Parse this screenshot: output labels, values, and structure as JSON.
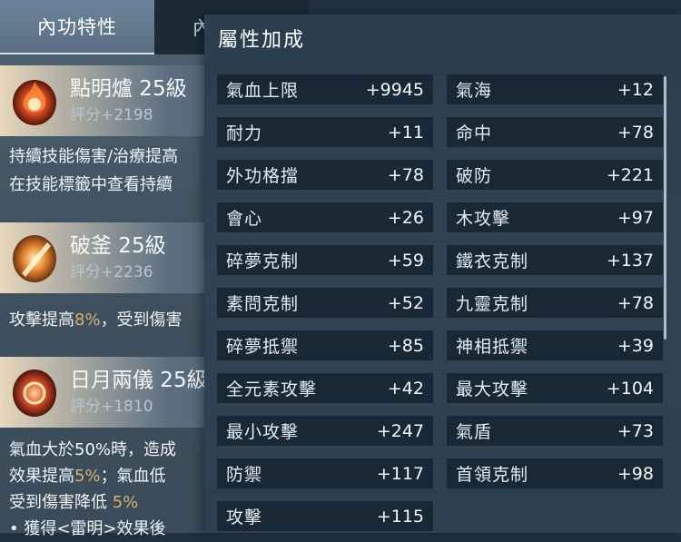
{
  "left_panel": {
    "tabs": [
      {
        "label": "內功特性"
      },
      {
        "label": "內"
      }
    ],
    "skills": [
      {
        "name": "點明爐 25級",
        "score": "評分+2198",
        "desc_lines": [
          "持續技能傷害/治療提高",
          "在技能標籤中查看持續"
        ]
      },
      {
        "name": "破釜 25級",
        "score": "評分+2236",
        "desc_parts": [
          "攻擊提高",
          "8%",
          "，受到傷害"
        ]
      },
      {
        "name": "日月兩儀 25級",
        "score": "評分+1810",
        "desc_lines": [
          "氣血大於50%時，造成",
          "效果提高",
          "5%",
          "；氣血低",
          "受到傷害降低 ",
          "5%",
          "• 獲得<雷明>效果後"
        ]
      }
    ]
  },
  "popup": {
    "title": "屬性加成",
    "attributes": [
      {
        "label": "氣血上限",
        "value": "+9945"
      },
      {
        "label": "氣海",
        "value": "+12"
      },
      {
        "label": "耐力",
        "value": "+11"
      },
      {
        "label": "命中",
        "value": "+78"
      },
      {
        "label": "外功格擋",
        "value": "+78"
      },
      {
        "label": "破防",
        "value": "+221"
      },
      {
        "label": "會心",
        "value": "+26"
      },
      {
        "label": "木攻擊",
        "value": "+97"
      },
      {
        "label": "碎夢克制",
        "value": "+59"
      },
      {
        "label": "鐵衣克制",
        "value": "+137"
      },
      {
        "label": "素問克制",
        "value": "+52"
      },
      {
        "label": "九靈克制",
        "value": "+78"
      },
      {
        "label": "碎夢抵禦",
        "value": "+85"
      },
      {
        "label": "神相抵禦",
        "value": "+39"
      },
      {
        "label": "全元素攻擊",
        "value": "+42"
      },
      {
        "label": "最大攻擊",
        "value": "+104"
      },
      {
        "label": "最小攻擊",
        "value": "+247"
      },
      {
        "label": "氣盾",
        "value": "+73"
      },
      {
        "label": "防禦",
        "value": "+117"
      },
      {
        "label": "首領克制",
        "value": "+98"
      },
      {
        "label": "攻擊",
        "value": "+115"
      }
    ]
  },
  "colors": {
    "highlight": "#d8b071",
    "row_bg": "#111f2a"
  },
  "icons": [
    "fire-flower-icon",
    "blade-sun-icon",
    "sun-moon-icon"
  ]
}
